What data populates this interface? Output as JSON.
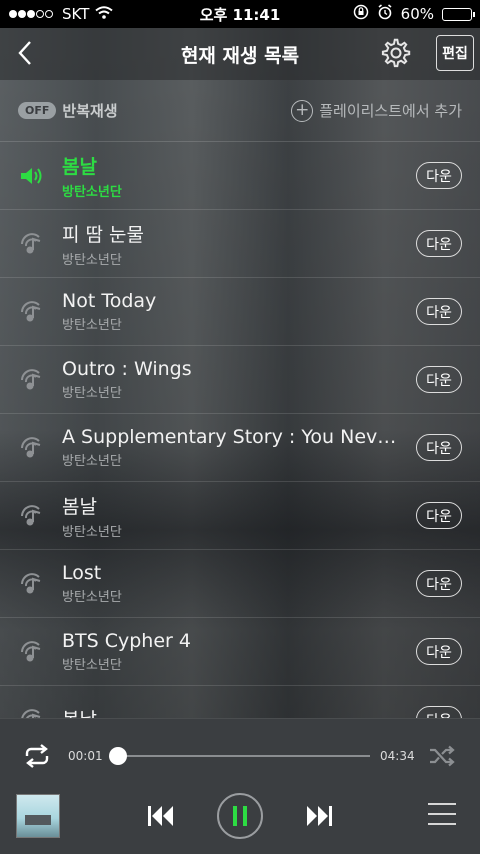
{
  "status": {
    "carrier": "SKT",
    "time": "오후 11:41",
    "battery": "60%",
    "battery_level": 0.6
  },
  "header": {
    "title": "현재 재생 목록",
    "edit_label": "편집"
  },
  "options": {
    "repeat_badge": "OFF",
    "repeat_label": "반복재생",
    "add_playlist_label": "플레이리스트에서 추가"
  },
  "tracks": [
    {
      "title": "봄날",
      "artist": "방탄소년단",
      "down": "다운",
      "playing": true
    },
    {
      "title": "피 땀 눈물",
      "artist": "방탄소년단",
      "down": "다운",
      "playing": false
    },
    {
      "title": "Not Today",
      "artist": "방탄소년단",
      "down": "다운",
      "playing": false
    },
    {
      "title": "Outro : Wings",
      "artist": "방탄소년단",
      "down": "다운",
      "playing": false
    },
    {
      "title": "A Supplementary Story : You Nev…",
      "artist": "방탄소년단",
      "down": "다운",
      "playing": false
    },
    {
      "title": "봄날",
      "artist": "방탄소년단",
      "down": "다운",
      "playing": false
    },
    {
      "title": "Lost",
      "artist": "방탄소년단",
      "down": "다운",
      "playing": false
    },
    {
      "title": "BTS Cypher 4",
      "artist": "방탄소년단",
      "down": "다운",
      "playing": false
    },
    {
      "title": "봄날",
      "artist": "",
      "down": "다운",
      "playing": false
    }
  ],
  "player": {
    "current_time": "00:01",
    "total_time": "04:34",
    "progress": 0.004
  },
  "colors": {
    "accent": "#2ddc43",
    "background": "#3d4144"
  }
}
